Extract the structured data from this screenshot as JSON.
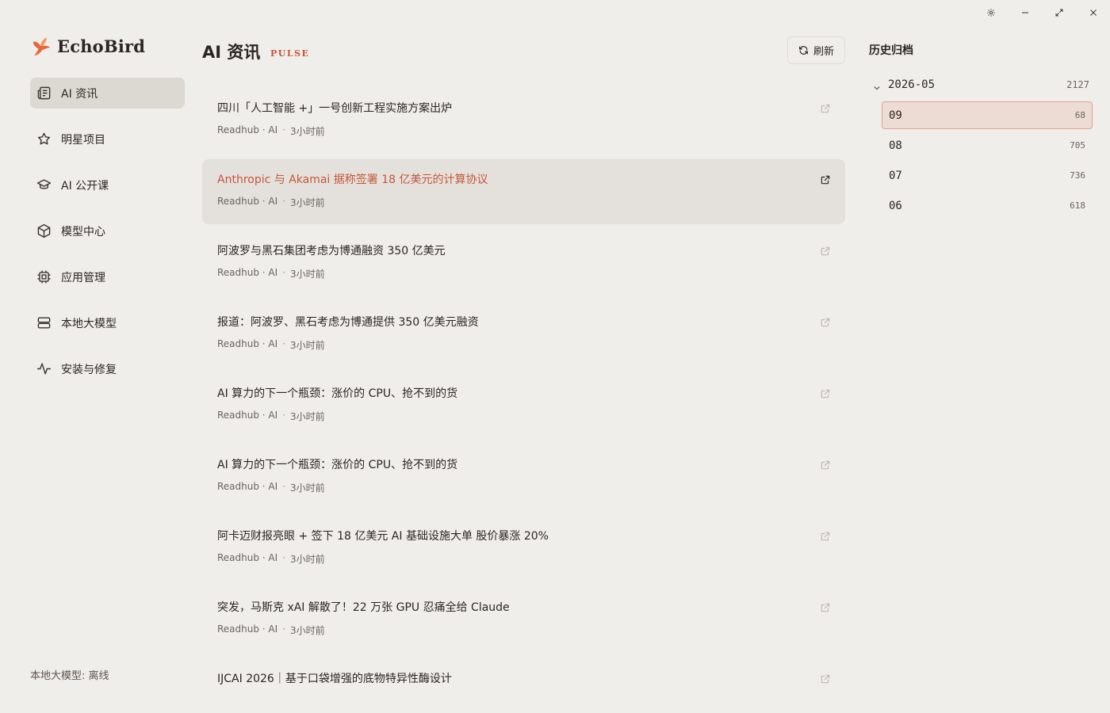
{
  "app": {
    "name": "EchoBird"
  },
  "window_controls": [
    "settings",
    "minimize",
    "maximize",
    "close"
  ],
  "sidebar": {
    "items": [
      {
        "label": "AI 资讯",
        "icon": "newspaper-icon",
        "active": true
      },
      {
        "label": "明星项目",
        "icon": "star-icon",
        "active": false
      },
      {
        "label": "AI 公开课",
        "icon": "graduation-cap-icon",
        "active": false
      },
      {
        "label": "模型中心",
        "icon": "cube-icon",
        "active": false
      },
      {
        "label": "应用管理",
        "icon": "chip-icon",
        "active": false
      },
      {
        "label": "本地大模型",
        "icon": "server-icon",
        "active": false
      },
      {
        "label": "安装与修复",
        "icon": "activity-icon",
        "active": false
      }
    ],
    "status": "本地大模型: 离线"
  },
  "main": {
    "title": "AI 资讯",
    "subtitle": "PULSE",
    "refresh_label": "刷新",
    "news": [
      {
        "title": "四川「人工智能 +」一号创新工程实施方案出炉",
        "source": "Readhub · AI",
        "time": "3小时前",
        "highlight": false
      },
      {
        "title": "Anthropic 与 Akamai 据称签署 18 亿美元的计算协议",
        "source": "Readhub · AI",
        "time": "3小时前",
        "highlight": true
      },
      {
        "title": "阿波罗与黑石集团考虑为博通融资 350 亿美元",
        "source": "Readhub · AI",
        "time": "3小时前",
        "highlight": false
      },
      {
        "title": "报道：阿波罗、黑石考虑为博通提供 350 亿美元融资",
        "source": "Readhub · AI",
        "time": "3小时前",
        "highlight": false
      },
      {
        "title": "AI 算力的下一个瓶颈：涨价的 CPU、抢不到的货",
        "source": "Readhub · AI",
        "time": "3小时前",
        "highlight": false
      },
      {
        "title": "AI 算力的下一个瓶颈：涨价的 CPU、抢不到的货",
        "source": "Readhub · AI",
        "time": "3小时前",
        "highlight": false
      },
      {
        "title": "阿卡迈财报亮眼 + 签下 18 亿美元 AI 基础设施大单 股价暴涨 20%",
        "source": "Readhub · AI",
        "time": "3小时前",
        "highlight": false
      },
      {
        "title": "突发，马斯克 xAI 解散了！22 万张 GPU 忍痛全给 Claude",
        "source": "Readhub · AI",
        "time": "3小时前",
        "highlight": false
      },
      {
        "title": "IJCAI 2026｜基于口袋增强的底物特异性酶设计",
        "source": "",
        "time": "",
        "highlight": false
      }
    ]
  },
  "archive": {
    "title": "历史归档",
    "group": {
      "label": "2026-05",
      "count": "2127",
      "expanded": true
    },
    "days": [
      {
        "label": "09",
        "count": "68",
        "active": true
      },
      {
        "label": "08",
        "count": "705",
        "active": false
      },
      {
        "label": "07",
        "count": "736",
        "active": false
      },
      {
        "label": "06",
        "count": "618",
        "active": false
      }
    ]
  },
  "colors": {
    "accent": "#c5563a",
    "background": "#f0eeea",
    "active_nav": "#dcd9d2",
    "active_day_bg": "#eddcd4",
    "active_day_border": "#e0a18c"
  }
}
